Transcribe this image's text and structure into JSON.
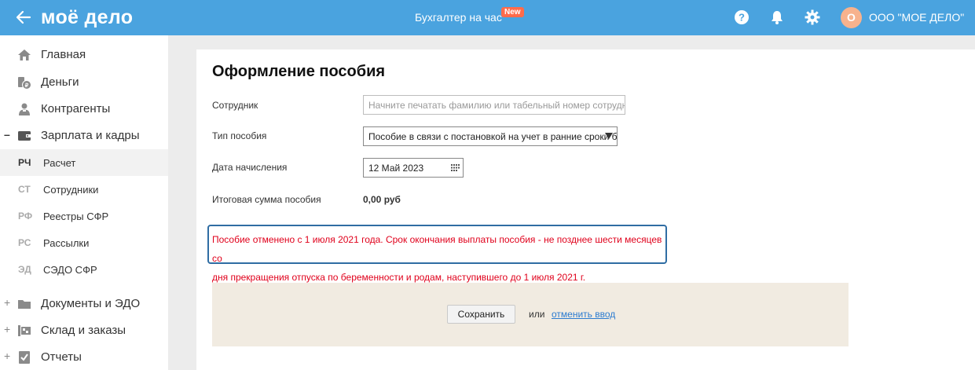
{
  "header": {
    "logo": "моё дело",
    "center_link": "Бухгалтер на час",
    "new_badge": "New",
    "avatar_letter": "О",
    "company": "ООО \"МОЕ ДЕЛО\"",
    "icons": [
      "back-arrow-icon",
      "help-icon",
      "bell-icon",
      "gear-icon"
    ],
    "bg_color": "#4aa3df"
  },
  "sidebar": {
    "items": [
      {
        "label": "Главная",
        "icon": "home-icon"
      },
      {
        "label": "Деньги",
        "icon": "money-icon"
      },
      {
        "label": "Контрагенты",
        "icon": "contractors-icon"
      },
      {
        "label": "Зарплата и кадры",
        "icon": "wallet-icon",
        "toggle": "–"
      },
      {
        "label": "Документы и ЭДО",
        "icon": "folder-icon",
        "toggle": "+"
      },
      {
        "label": "Склад и заказы",
        "icon": "warehouse-icon",
        "toggle": "+"
      },
      {
        "label": "Отчеты",
        "icon": "reports-icon",
        "toggle": "+"
      }
    ],
    "subitems": [
      {
        "abbr": "РЧ",
        "label": "Расчет"
      },
      {
        "abbr": "СТ",
        "label": "Сотрудники"
      },
      {
        "abbr": "РФ",
        "label": "Реестры СФР"
      },
      {
        "abbr": "РС",
        "label": "Рассылки"
      },
      {
        "abbr": "ЭД",
        "label": "СЭДО СФР"
      }
    ]
  },
  "form": {
    "title": "Оформление пособия",
    "employee_label": "Сотрудник",
    "employee_placeholder": "Начните печатать фамилию или табельный номер сотрудника",
    "type_label": "Тип пособия",
    "type_value": "Пособие в связи с постановкой на учет в ранние сроки беременности",
    "date_label": "Дата начисления",
    "date_value": "12 Май 2023",
    "total_label": "Итоговая сумма пособия",
    "total_value": "0,00 руб",
    "warning_line1": "Пособие отменено с 1 июля 2021 года. Срок окончания выплаты пособия - не позднее шести месяцев со",
    "warning_line2": "дня прекращения отпуска по беременности и родам, наступившего до 1 июля 2021 г.",
    "save_label": "Сохранить",
    "or_text": "или",
    "cancel_label": "отменить ввод"
  }
}
